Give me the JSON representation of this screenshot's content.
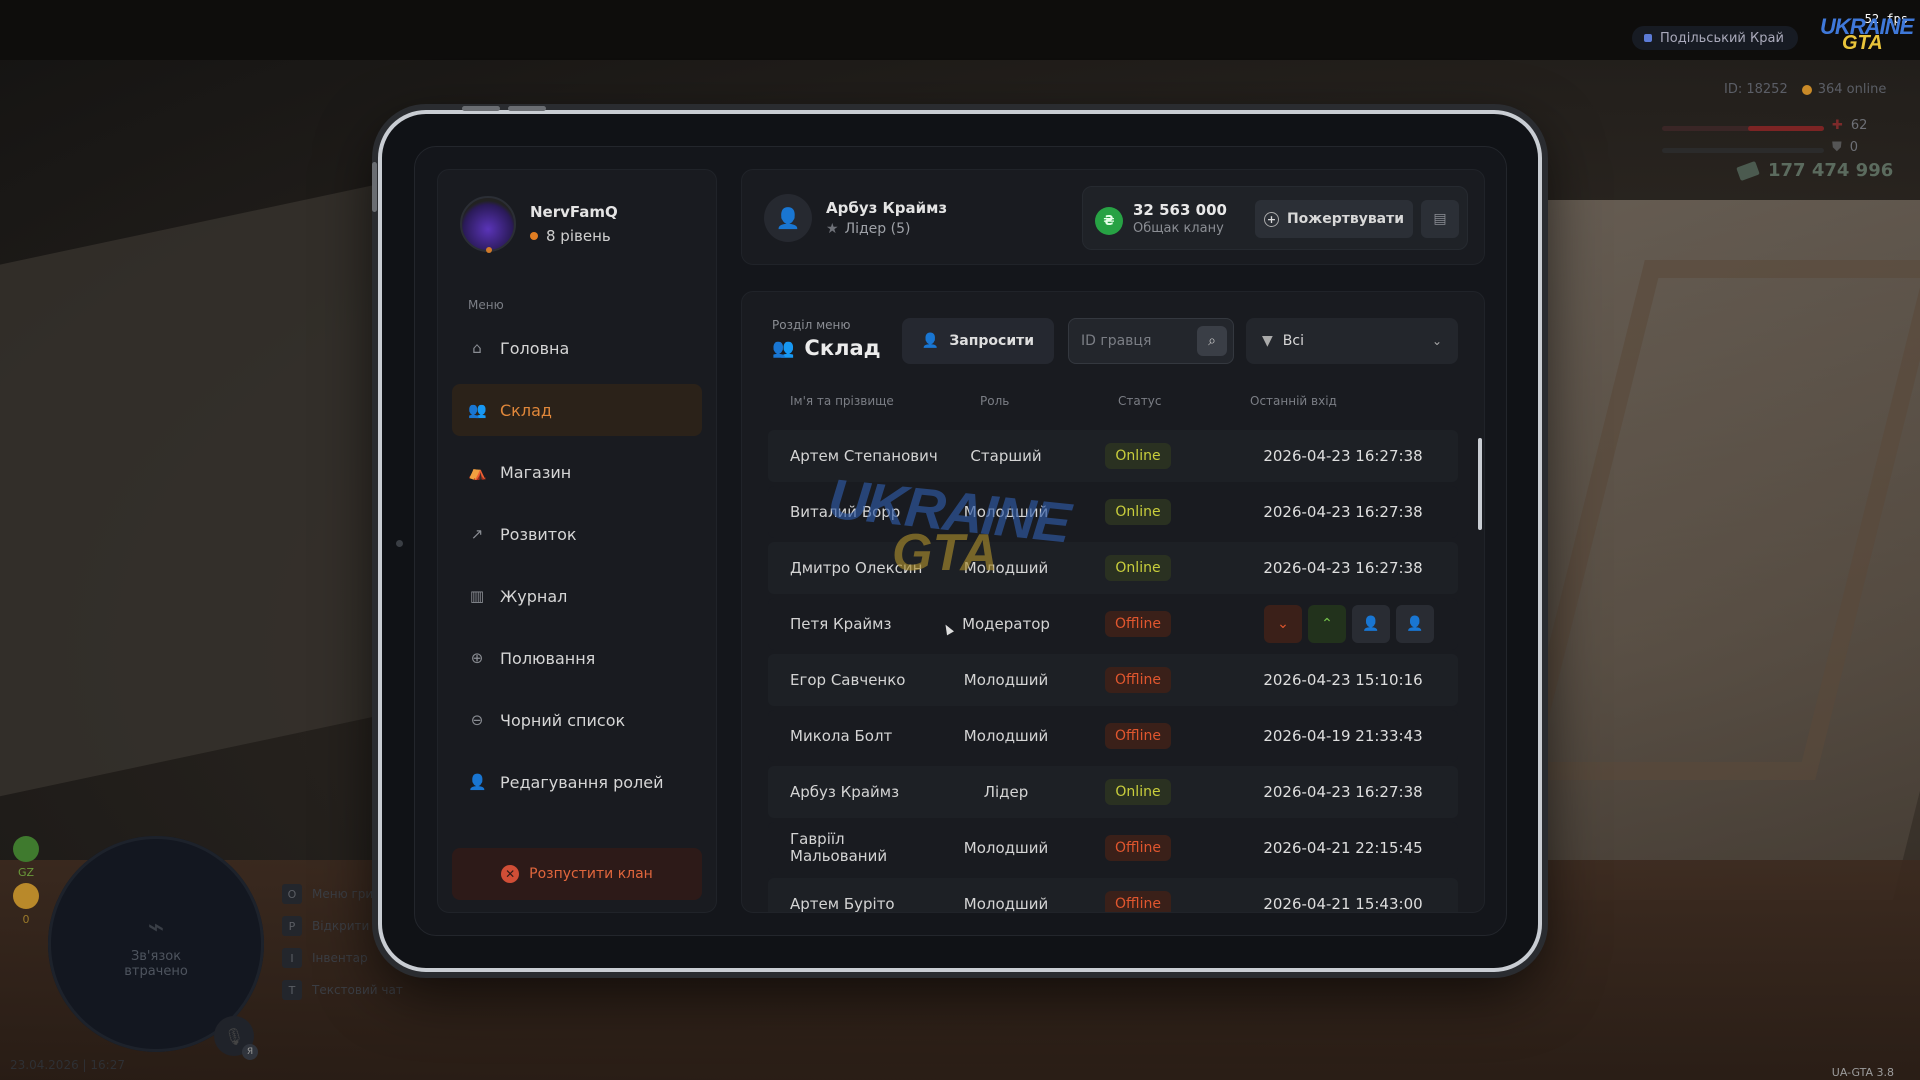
{
  "hud": {
    "fps": "52 fps",
    "server": "Подільський Край",
    "logo_top": "UKRAINE",
    "logo_bottom": "GTA",
    "player_id": "ID: 18252",
    "online": "364 online",
    "health": "62",
    "armor": "0",
    "money": "177 474 996",
    "minimap_text_1": "Зв'язок",
    "minimap_text_2": "втрачено",
    "gz_label": "GZ",
    "gz_value": "0",
    "mic_lang": "Я",
    "keys": [
      {
        "key": "O",
        "label": "Меню гри"
      },
      {
        "key": "P",
        "label": "Відкрити"
      },
      {
        "key": "I",
        "label": "Інвентар"
      },
      {
        "key": "T",
        "label": "Текстовий чат"
      }
    ],
    "datetime": "23.04.2026 | 16:27",
    "version": "UA-GTA 3.8"
  },
  "profile": {
    "name": "NervFamQ",
    "level": "8 рівень"
  },
  "menu": {
    "title": "Меню",
    "items": [
      {
        "label": "Головна",
        "icon": "home-icon"
      },
      {
        "label": "Склад",
        "icon": "people-icon"
      },
      {
        "label": "Магазин",
        "icon": "basket-icon"
      },
      {
        "label": "Розвиток",
        "icon": "chart-icon"
      },
      {
        "label": "Журнал",
        "icon": "book-icon"
      },
      {
        "label": "Полювання",
        "icon": "crosshair-icon"
      },
      {
        "label": "Чорний список",
        "icon": "block-icon"
      },
      {
        "label": "Редагування ролей",
        "icon": "user-edit-icon"
      }
    ],
    "active_index": 1,
    "disband_label": "Розпустити клан"
  },
  "leader": {
    "name": "Арбуз Краймз",
    "role": "Лідер (5)"
  },
  "treasury": {
    "currency_symbol": "₴",
    "amount": "32 563 000",
    "label": "Общак клану",
    "donate_label": "Пожертвувати"
  },
  "section": {
    "subtitle": "Розділ меню",
    "title": "Склад",
    "invite_label": "Запросити",
    "search_placeholder": "ID гравця",
    "filter_value": "Всі"
  },
  "table": {
    "headers": {
      "name": "Ім'я та прізвище",
      "role": "Роль",
      "status": "Статус",
      "last": "Останній вхід"
    },
    "rows": [
      {
        "name": "Артем Степанович",
        "role": "Старший",
        "status": "Online",
        "last": "2026-04-23 16:27:38"
      },
      {
        "name": "Виталий Ворр",
        "role": "Молодший",
        "status": "Online",
        "last": "2026-04-23 16:27:38"
      },
      {
        "name": "Дмитро Олексин",
        "role": "Молодший",
        "status": "Online",
        "last": "2026-04-23 16:27:38"
      },
      {
        "name": "Петя Краймз",
        "role": "Модератор",
        "status": "Offline",
        "last": ""
      },
      {
        "name": "Егор Савченко",
        "role": "Молодший",
        "status": "Offline",
        "last": "2026-04-23 15:10:16"
      },
      {
        "name": "Микола Болт",
        "role": "Молодший",
        "status": "Offline",
        "last": "2026-04-19 21:33:43"
      },
      {
        "name": "Арбуз Краймз",
        "role": "Лідер",
        "status": "Online",
        "last": "2026-04-23 16:27:38"
      },
      {
        "name": "Гавріїл Мальований",
        "role": "Молодший",
        "status": "Offline",
        "last": "2026-04-21 22:15:45"
      },
      {
        "name": "Артем Буріто",
        "role": "Молодший",
        "status": "Offline",
        "last": "2026-04-21 15:43:00"
      }
    ],
    "hovered_index": 3
  },
  "watermark": {
    "top": "UKRAINE",
    "bottom": "GTA"
  },
  "colors": {
    "accent": "#e0873a",
    "online": "#c9ce3c",
    "offline": "#e0562e",
    "money_green": "#27a244"
  }
}
